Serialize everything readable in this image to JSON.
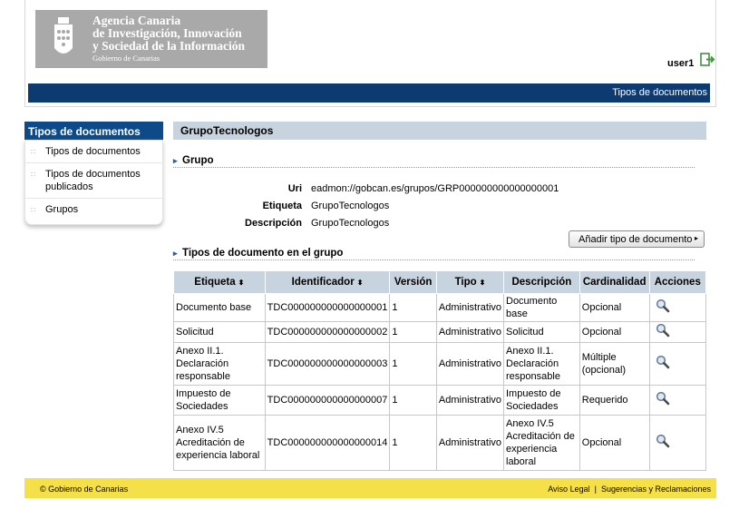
{
  "header": {
    "org_name": "Agencia Canaria\nde Investigación, Innovación\ny Sociedad de la Información",
    "gov_name": "Gobierno de Canarias",
    "username": "user1",
    "breadcrumb": "Tipos de documentos"
  },
  "sidebar": {
    "title": "Tipos de documentos",
    "items": [
      {
        "label": "Tipos de documentos"
      },
      {
        "label": "Tipos de documentos publicados"
      },
      {
        "label": "Grupos"
      }
    ]
  },
  "main": {
    "title": "GrupoTecnologos",
    "group_section": "Grupo",
    "fields": [
      {
        "label": "Uri",
        "value": "eadmon://gobcan.es/grupos/GRP000000000000000001"
      },
      {
        "label": "Etiqueta",
        "value": "GrupoTecnologos"
      },
      {
        "label": "Descripción",
        "value": "GrupoTecnologos"
      }
    ],
    "doc_section": "Tipos de documento en el grupo",
    "add_button": "Añadir tipo de documento",
    "table": {
      "headers": [
        "Etiqueta",
        "Identificador",
        "Versión",
        "Tipo",
        "Descripción",
        "Cardinalidad",
        "Acciones"
      ],
      "rows": [
        [
          "Documento base",
          "TDC000000000000000001",
          "1",
          "Administrativo",
          "Documento base",
          "Opcional"
        ],
        [
          "Solicitud",
          "TDC000000000000000002",
          "1",
          "Administrativo",
          "Solicitud",
          "Opcional"
        ],
        [
          "Anexo II.1. Declaración responsable",
          "TDC000000000000000003",
          "1",
          "Administrativo",
          "Anexo II.1. Declaración responsable",
          "Múltiple (opcional)"
        ],
        [
          "Impuesto de Sociedades",
          "TDC000000000000000007",
          "1",
          "Administrativo",
          "Impuesto de Sociedades",
          "Requerido"
        ],
        [
          "Anexo IV.5 Acreditación de experiencia laboral",
          "TDC000000000000000014",
          "1",
          "Administrativo",
          "Anexo IV.5 Acreditación de experiencia laboral",
          "Opcional"
        ]
      ],
      "action_icon": "magnifier-icon"
    }
  },
  "footer": {
    "copyright": "© Gobierno de Canarias",
    "legal": "Aviso Legal",
    "suggestions": "Sugerencias y Reclamaciones"
  },
  "colors": {
    "topbar": "#0d3a70",
    "sidebar_head": "#0e4a8a",
    "table_head": "#c7d3de",
    "footer": "#f5e04a"
  }
}
